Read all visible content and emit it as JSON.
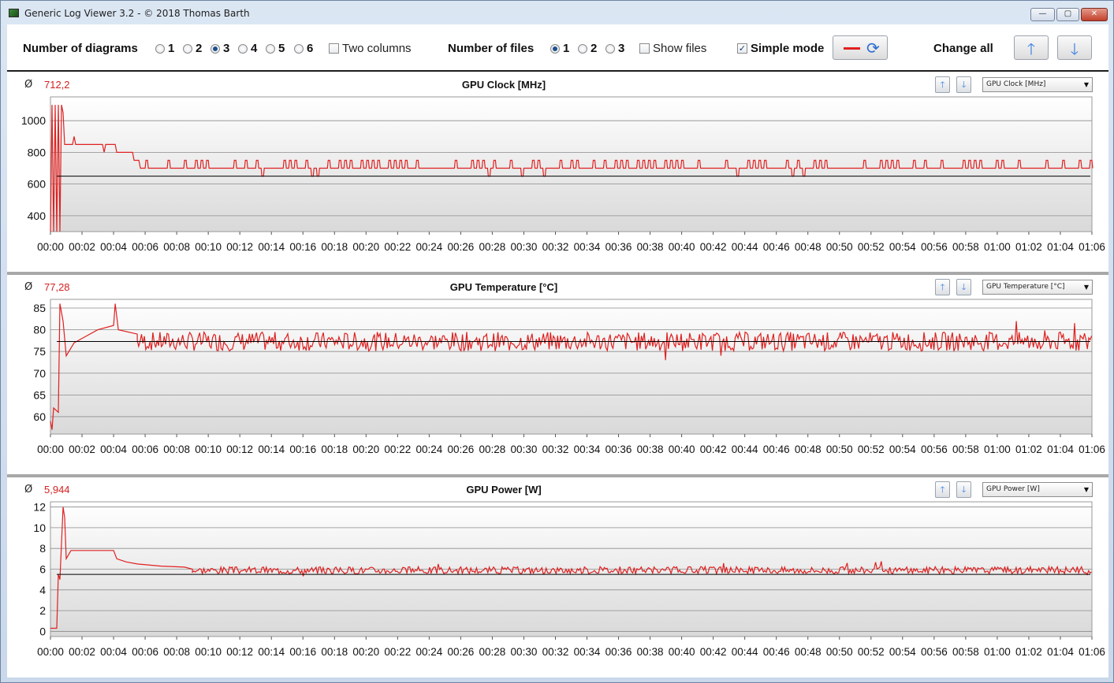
{
  "window": {
    "title": "Generic Log Viewer 3.2 - © 2018 Thomas Barth",
    "controls": {
      "minimize": "—",
      "maximize": "▢",
      "close": "✕"
    }
  },
  "toolbar": {
    "num_diagrams_label": "Number of diagrams",
    "diagram_options": [
      "1",
      "2",
      "3",
      "4",
      "5",
      "6"
    ],
    "diagram_selected": "3",
    "two_columns_label": "Two columns",
    "two_columns_checked": false,
    "num_files_label": "Number of files",
    "file_options": [
      "1",
      "2",
      "3"
    ],
    "file_selected": "1",
    "show_files_label": "Show files",
    "show_files_checked": false,
    "simple_mode_label": "Simple mode",
    "simple_mode_checked": true,
    "change_all_label": "Change all"
  },
  "icons": {
    "app": "app-icon",
    "refresh": "refresh-icon",
    "up": "arrow-up-icon",
    "down": "arrow-down-icon"
  },
  "colors": {
    "series": "#e02020",
    "average_line": "#000000",
    "accent": "#3c82e0"
  },
  "time_ticks": [
    "00:00",
    "00:02",
    "00:04",
    "00:06",
    "00:08",
    "00:10",
    "00:12",
    "00:14",
    "00:16",
    "00:18",
    "00:20",
    "00:22",
    "00:24",
    "00:26",
    "00:28",
    "00:30",
    "00:32",
    "00:34",
    "00:36",
    "00:38",
    "00:40",
    "00:42",
    "00:44",
    "00:46",
    "00:48",
    "00:50",
    "00:52",
    "00:54",
    "00:56",
    "00:58",
    "01:00",
    "01:02",
    "01:04",
    "01:06"
  ],
  "panels": [
    {
      "avg_symbol": "Ø",
      "average": "712,2",
      "title": "GPU Clock [MHz]",
      "select_value": "GPU Clock [MHz]"
    },
    {
      "avg_symbol": "Ø",
      "average": "77,28",
      "title": "GPU Temperature [°C]",
      "select_value": "GPU Temperature [°C]"
    },
    {
      "avg_symbol": "Ø",
      "average": "5,944",
      "title": "GPU Power [W]",
      "select_value": "GPU Power [W]"
    }
  ],
  "chart_data": [
    {
      "type": "line",
      "title": "GPU Clock [MHz]",
      "xlabel": "",
      "ylabel": "",
      "xlim_minutes": [
        0,
        66
      ],
      "ylim": [
        300,
        1150
      ],
      "yticks": [
        400,
        600,
        800,
        1000
      ],
      "grid": true,
      "average_line": 650,
      "series": [
        {
          "points": [
            [
              0,
              300
            ],
            [
              0.1,
              1100
            ],
            [
              0.2,
              300
            ],
            [
              0.3,
              1100
            ],
            [
              0.4,
              300
            ],
            [
              0.5,
              1100
            ],
            [
              0.6,
              300
            ],
            [
              0.7,
              1100
            ],
            [
              0.8,
              1050
            ],
            [
              0.9,
              850
            ],
            [
              1.4,
              850
            ],
            [
              1.5,
              900
            ],
            [
              1.6,
              850
            ],
            [
              3.3,
              850
            ],
            [
              3.4,
              800
            ],
            [
              3.5,
              850
            ],
            [
              4.1,
              850
            ],
            [
              4.2,
              800
            ],
            [
              5.2,
              800
            ],
            [
              5.3,
              750
            ],
            [
              5.6,
              750
            ],
            [
              5.7,
              700
            ],
            [
              6.0,
              750
            ],
            [
              8.9,
              750
            ],
            [
              9.0,
              700
            ],
            [
              16.5,
              700
            ],
            [
              16.6,
              600
            ],
            [
              16.7,
              700
            ],
            [
              19.5,
              700
            ],
            [
              19.6,
              650
            ],
            [
              20.3,
              650
            ],
            [
              20.4,
              700
            ],
            [
              20.7,
              700
            ],
            [
              20.8,
              650
            ],
            [
              21.3,
              650
            ],
            [
              21.4,
              600
            ],
            [
              21.5,
              700
            ],
            [
              30.0,
              700
            ],
            [
              30.1,
              650
            ],
            [
              30.3,
              700
            ],
            [
              35.8,
              700
            ],
            [
              35.9,
              600
            ],
            [
              36.0,
              700
            ],
            [
              49.0,
              700
            ],
            [
              60.0,
              700
            ],
            [
              60.1,
              650
            ],
            [
              61.0,
              650
            ],
            [
              61.1,
              700
            ],
            [
              66.0,
              700
            ]
          ],
          "spikes": {
            "every_minutes": 0.35,
            "high": 750,
            "low": 650,
            "seed": 11,
            "start": 6,
            "end": 66,
            "base": 700
          }
        }
      ]
    },
    {
      "type": "line",
      "title": "GPU Temperature [°C]",
      "xlabel": "",
      "ylabel": "",
      "xlim_minutes": [
        0,
        66
      ],
      "ylim": [
        56,
        87
      ],
      "yticks": [
        60,
        65,
        70,
        75,
        80,
        85
      ],
      "grid": true,
      "average_line": 77.3,
      "series": [
        {
          "points": [
            [
              0,
              59
            ],
            [
              0.1,
              57
            ],
            [
              0.2,
              62
            ],
            [
              0.5,
              61
            ],
            [
              0.6,
              86
            ],
            [
              0.8,
              82
            ],
            [
              1.0,
              74
            ],
            [
              1.5,
              77
            ],
            [
              2.0,
              78
            ],
            [
              3.0,
              80
            ],
            [
              4.0,
              81
            ],
            [
              4.1,
              86
            ],
            [
              4.3,
              80
            ],
            [
              5.5,
              79
            ],
            [
              6.0,
              77
            ],
            [
              66.0,
              77
            ]
          ],
          "noise": {
            "amp": 2.2,
            "base": 77.3,
            "start": 5.5,
            "end": 66,
            "seed": 7
          }
        }
      ]
    },
    {
      "type": "line",
      "title": "GPU Power [W]",
      "xlabel": "",
      "ylabel": "",
      "xlim_minutes": [
        0,
        66
      ],
      "ylim": [
        -0.5,
        12.5
      ],
      "yticks": [
        0,
        2,
        4,
        6,
        8,
        10,
        12
      ],
      "grid": true,
      "average_line": 5.5,
      "series": [
        {
          "points": [
            [
              0,
              0.3
            ],
            [
              0.4,
              0.3
            ],
            [
              0.5,
              5.5
            ],
            [
              0.6,
              5.0
            ],
            [
              0.8,
              12
            ],
            [
              0.9,
              11
            ],
            [
              1.0,
              7
            ],
            [
              1.3,
              7.8
            ],
            [
              4.0,
              7.8
            ],
            [
              4.2,
              7.0
            ],
            [
              4.8,
              6.7
            ],
            [
              5.5,
              6.5
            ],
            [
              7.0,
              6.3
            ],
            [
              8.5,
              6.2
            ],
            [
              9.0,
              6.0
            ],
            [
              10.0,
              6.0
            ],
            [
              66.0,
              5.8
            ]
          ],
          "noise": {
            "amp": 0.35,
            "base": 5.9,
            "start": 9,
            "end": 66,
            "seed": 3
          }
        }
      ]
    }
  ]
}
